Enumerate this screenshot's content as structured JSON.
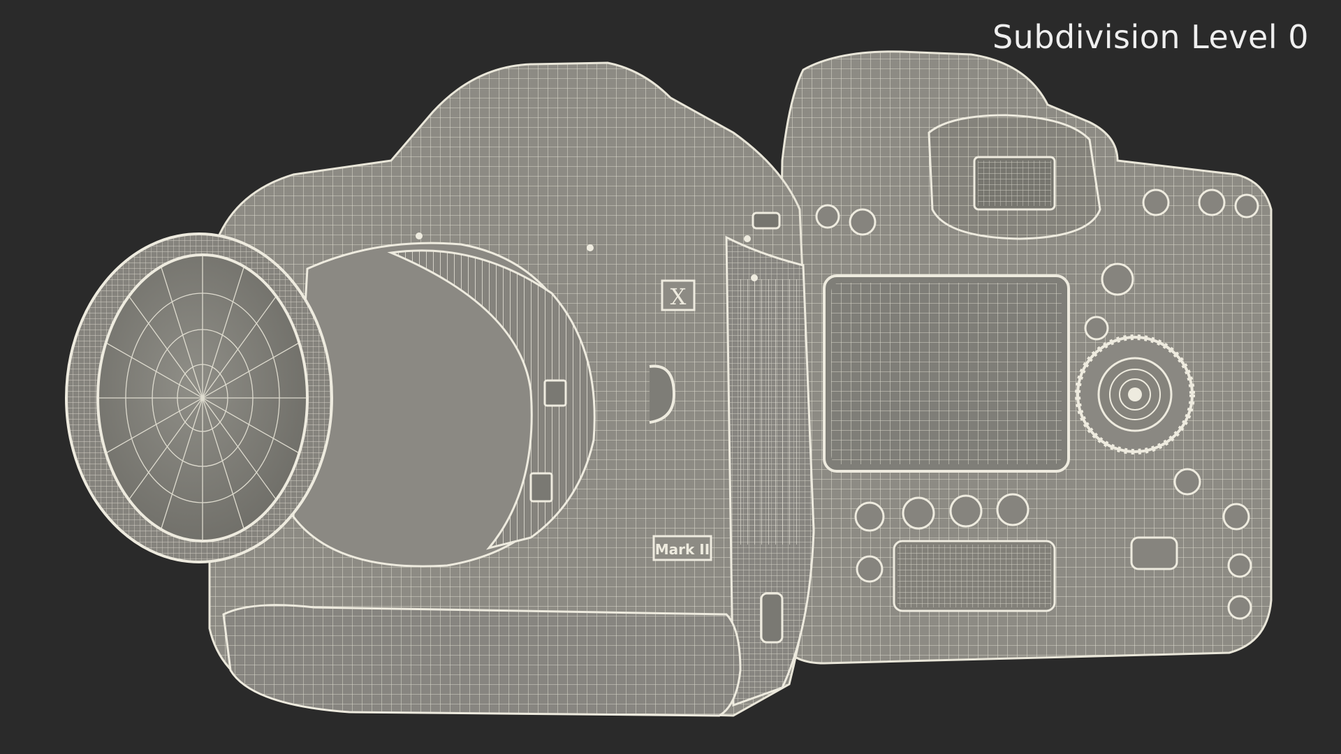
{
  "viewport": {
    "background": "#2a2a2a",
    "overlay_label": "Subdivision Level 0"
  },
  "model": {
    "subject": "dslr-camera-with-battery-grip",
    "surface_color": "#8d8b84",
    "wire_color": "#e9e6d9",
    "badges": {
      "model_letter": "X",
      "edition": "Mark II"
    }
  }
}
